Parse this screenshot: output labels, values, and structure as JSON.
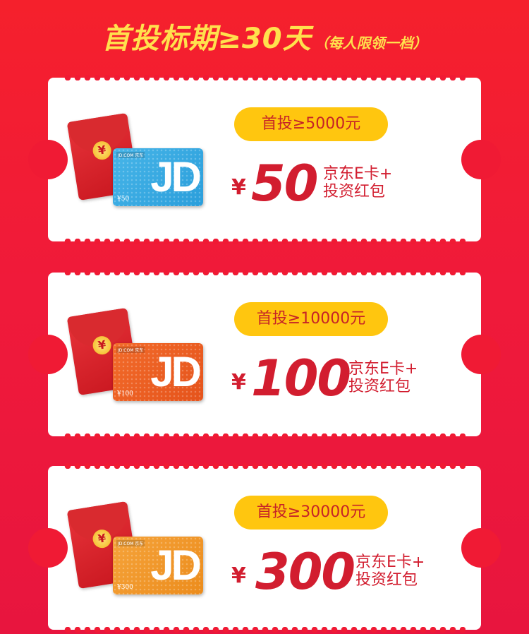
{
  "header": {
    "title": "首投标期≥30天",
    "note": "（每人限领一档）"
  },
  "tickets": [
    {
      "card_brand": "JD.COM 京东",
      "card_logo": "JD",
      "card_value": "¥50",
      "card_color": "#2a9edb",
      "condition": "首投≥5000元",
      "currency": "¥",
      "amount": "50",
      "reward_line1": "京东E卡+",
      "reward_line2": "投资红包"
    },
    {
      "card_brand": "JD.COM 京东",
      "card_logo": "JD",
      "card_value": "¥100",
      "card_color": "#e5531b",
      "condition": "首投≥10000元",
      "currency": "¥",
      "amount": "100",
      "reward_line1": "京东E卡+",
      "reward_line2": "投资红包"
    },
    {
      "card_brand": "JD.COM 京东",
      "card_logo": "JD",
      "card_value": "¥300",
      "card_color": "#ec8c1c",
      "condition": "首投≥30000元",
      "currency": "¥",
      "amount": "300",
      "reward_line1": "京东E卡+",
      "reward_line2": "投资红包"
    }
  ],
  "colors": {
    "background": "#f01a34",
    "title": "#ffe14d",
    "pill": "#ffc60f",
    "accent_red": "#d21d2f"
  }
}
